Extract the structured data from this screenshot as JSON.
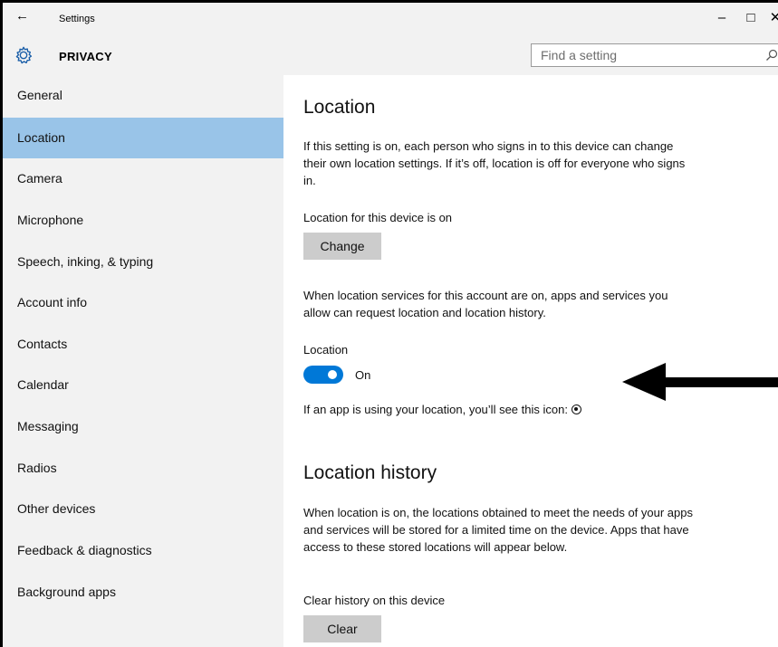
{
  "window": {
    "title": "Settings",
    "back_glyph": "←",
    "minimize_glyph": "–",
    "maximize_glyph": "□",
    "close_glyph": "✕"
  },
  "header": {
    "section": "PRIVACY",
    "icon": "gear-icon",
    "search_placeholder": "Find a setting",
    "search_icon": "search-icon"
  },
  "sidebar": {
    "items": [
      {
        "label": "General"
      },
      {
        "label": "Location",
        "active": true
      },
      {
        "label": "Camera"
      },
      {
        "label": "Microphone"
      },
      {
        "label": "Speech, inking, & typing"
      },
      {
        "label": "Account info"
      },
      {
        "label": "Contacts"
      },
      {
        "label": "Calendar"
      },
      {
        "label": "Messaging"
      },
      {
        "label": "Radios"
      },
      {
        "label": "Other devices"
      },
      {
        "label": "Feedback & diagnostics"
      },
      {
        "label": "Background apps"
      }
    ]
  },
  "content": {
    "location_heading": "Location",
    "location_desc": "If this setting is on, each person who signs in to this device can change their own location settings. If it’s off, location is off for everyone who signs in.",
    "device_status": "Location for this device is on",
    "change_button": "Change",
    "services_desc": "When location services for this account are on, apps and services you allow can request location and location history.",
    "toggle_label": "Location",
    "toggle_state": "On",
    "toggle_on": true,
    "icon_note": "If an app is using your location, you’ll see this icon:",
    "history_heading": "Location history",
    "history_desc": "When location is on, the locations obtained to meet the needs of your apps and services will be stored for a limited time on the device. Apps that have access to these stored locations will appear below.",
    "clear_label": "Clear history on this device",
    "clear_button": "Clear"
  },
  "colors": {
    "accent": "#0078d7",
    "active_nav": "#99c4e8",
    "chrome": "#f2f2f2",
    "button": "#cccccc"
  }
}
